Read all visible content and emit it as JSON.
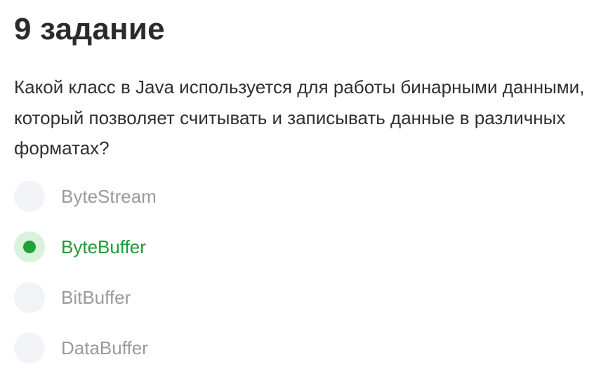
{
  "task": {
    "title": "9 задание",
    "question": "Какой класс в Java используется для работы бинарными данными, который позволяет считывать и записывать данные в различных форматах?"
  },
  "options": [
    {
      "label": "ByteStream",
      "selected": false
    },
    {
      "label": "ByteBuffer",
      "selected": true
    },
    {
      "label": "BitBuffer",
      "selected": false
    },
    {
      "label": "DataBuffer",
      "selected": false
    }
  ],
  "colors": {
    "selected_accent": "#22a03a",
    "selected_background": "#d8f2dc",
    "unselected_radio": "#f2f3f6",
    "unselected_text": "#9a9a9a",
    "title_text": "#2b2b2b"
  }
}
